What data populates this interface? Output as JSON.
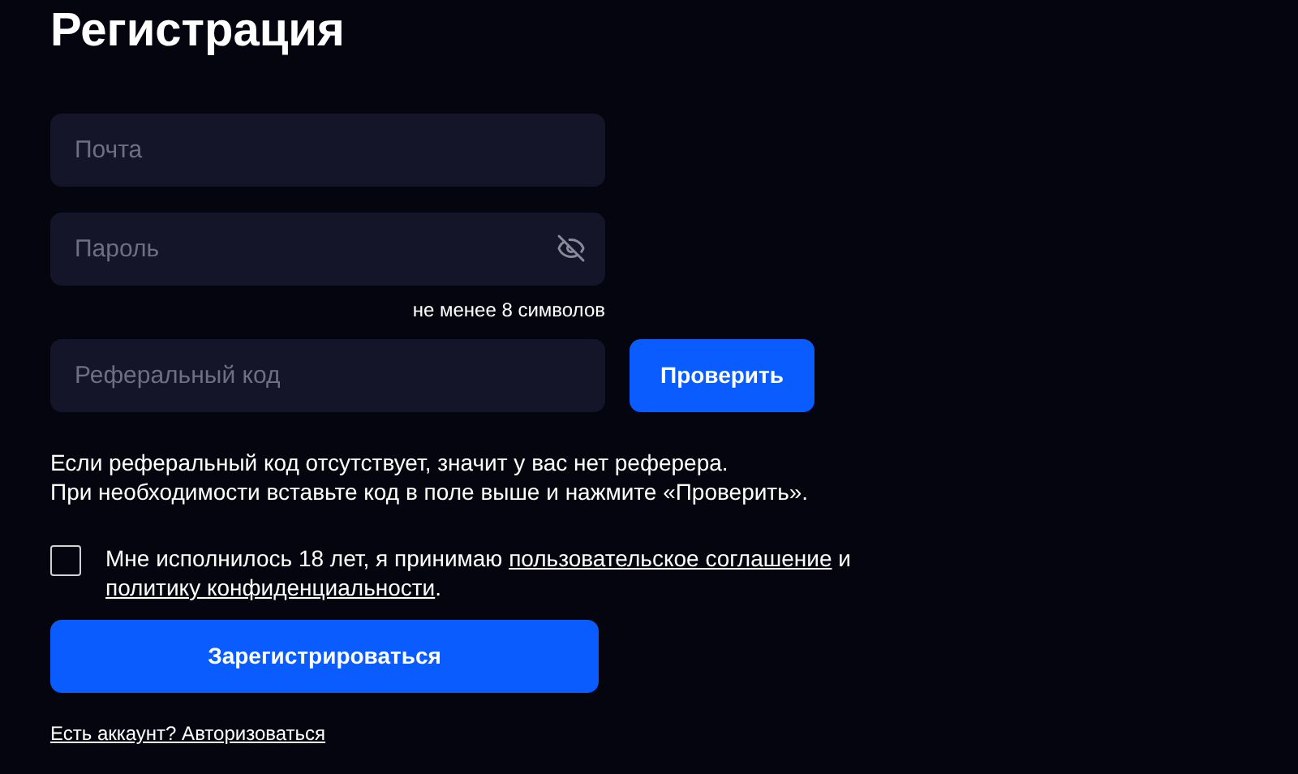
{
  "title": "Регистрация",
  "fields": [
    {
      "placeholder": "Почта",
      "kind": "text"
    },
    {
      "placeholder": "Пароль",
      "kind": "password"
    }
  ],
  "password_hint": "не менее 8 символов",
  "referral": {
    "placeholder": "Реферальный код",
    "button": "Проверить"
  },
  "referral_note": [
    "Если реферальный код отсутствует, значит у вас нет реферера.",
    "При необходимости вставьте код в поле выше и нажмите «Проверить»."
  ],
  "agreement": {
    "checked": false,
    "parts": [
      {
        "kind": "text",
        "text": "Мне исполнилось 18 лет, я принимаю "
      },
      {
        "kind": "link",
        "text": "пользовательское соглашение"
      },
      {
        "kind": "text",
        "text": " и "
      },
      {
        "kind": "link",
        "text": "политику "
      },
      {
        "kind": "link",
        "text": "конфиденциальности"
      },
      {
        "kind": "text",
        "text": "."
      }
    ]
  },
  "submit": "Зарегистрироваться",
  "login_link": "Есть аккаунт? Авторизоваться"
}
